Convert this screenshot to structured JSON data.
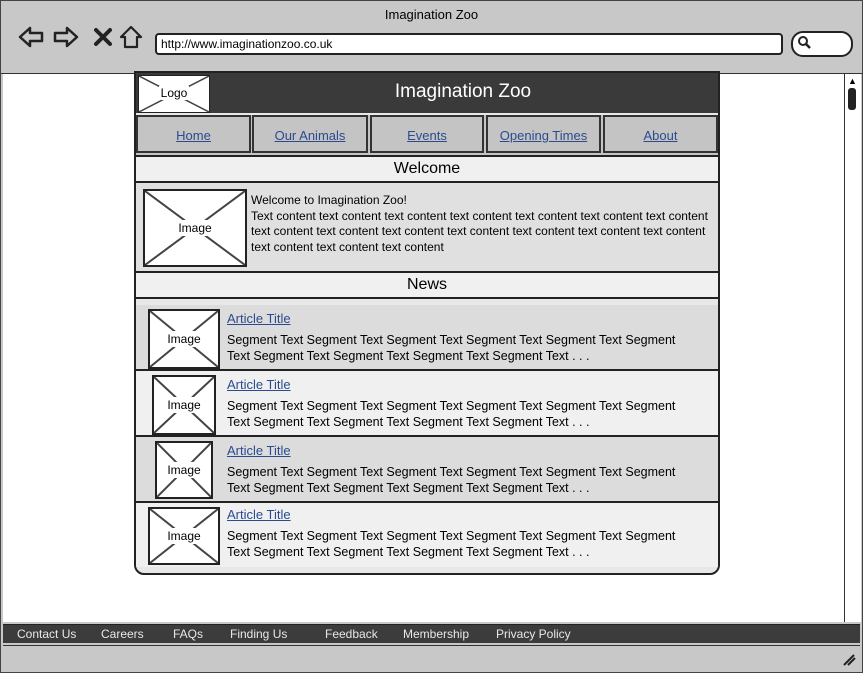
{
  "browser": {
    "title": "Imagination Zoo",
    "url": "http://www.imaginationzoo.co.uk",
    "back_icon": "back-arrow-icon",
    "forward_icon": "forward-arrow-icon",
    "stop_icon": "close-icon",
    "home_icon": "home-icon",
    "search_icon": "search-icon"
  },
  "site": {
    "logo": "Logo",
    "title": "Imagination Zoo",
    "nav": [
      "Home",
      "Our Animals",
      "Events",
      "Opening Times",
      "About"
    ],
    "welcome_heading": "Welcome",
    "welcome_image": "Image",
    "welcome_greeting": "Welcome to Imagination Zoo!",
    "welcome_body": "Text content text content text content text content text content text content text content text content text content text content text content text content text content text content text content text content text content",
    "news_heading": "News",
    "articles": [
      {
        "image": "Image",
        "title": "Article Title",
        "text": "Segment Text Segment Text Segment Text Segment Text Segment Text Segment Text Segment Text Segment Text Segment Text Segment Text . . ."
      },
      {
        "image": "Image",
        "title": "Article Title",
        "text": "Segment Text Segment Text Segment Text Segment Text Segment Text Segment Text Segment Text Segment Text Segment Text Segment Text . . ."
      },
      {
        "image": "Image",
        "title": "Article Title",
        "text": "Segment Text Segment Text Segment Text Segment Text Segment Text Segment Text Segment Text Segment Text Segment Text Segment Text . . ."
      },
      {
        "image": "Image",
        "title": "Article Title",
        "text": "Segment Text Segment Text Segment Text Segment Text Segment Text Segment Text Segment Text Segment Text Segment Text Segment Text . . ."
      }
    ]
  },
  "footer": [
    "Contact Us",
    "Careers",
    "FAQs",
    "Finding Us",
    "Feedback",
    "Membership",
    "Privacy Policy"
  ],
  "colors": {
    "header": "#3a3a3a",
    "link": "#2b4b8e",
    "chrome": "#c8c8c8"
  }
}
